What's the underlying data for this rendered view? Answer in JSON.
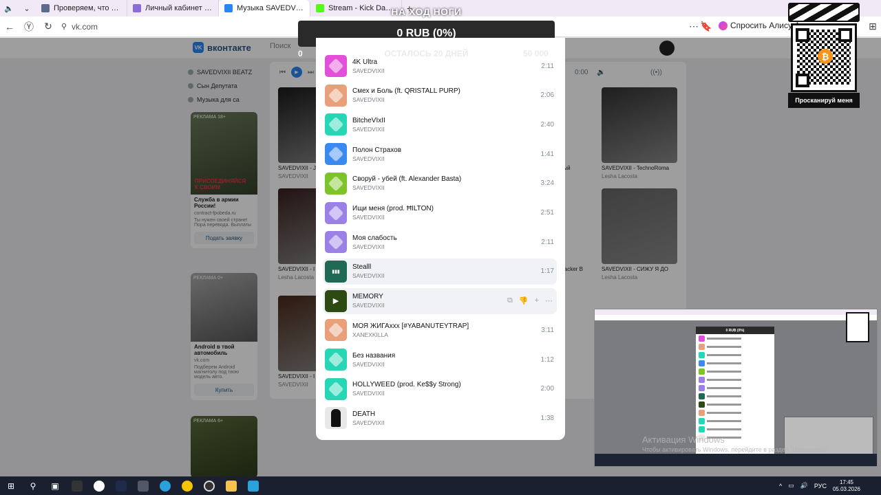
{
  "browser": {
    "tabs": [
      {
        "title": "Проверяем, что вы не ро",
        "color": "#5a6b8c"
      },
      {
        "title": "Личный кабинет - Мои об",
        "color": "#8a6cd8"
      },
      {
        "title": "Музыка SAVEDVIXII",
        "color": "#2787f5"
      },
      {
        "title": "Stream - Kick Dashb",
        "color": "#53fc18"
      }
    ],
    "active_tab": 2,
    "url": "vk.com",
    "alice_label": "Спросить Алису А"
  },
  "vk": {
    "logo": "вконтакте",
    "search_placeholder": "Поиск",
    "sidebar": [
      "SAVEDVIXII BEATZ",
      "Сын Депутата",
      "Музыка для са"
    ],
    "ad1": {
      "label": "РЕКЛАМА 18+",
      "title": "Служба в армии России!",
      "site": "contract-fpobeda.ru",
      "text": "Ты нужен своей стране! Пора перевода. Выплаты",
      "button": "Подать заявку",
      "promo": "ПРИСОЕДИНЯЙСЯ К СВОИМ"
    },
    "ad2": {
      "label": "РЕКЛАМА 0+",
      "title": "Android в твой автомобиль",
      "site": "vk.com",
      "text": "Подберем Android магнитолу под твою модель авто.",
      "button": "Купить"
    },
    "ad3": {
      "label": "РЕКЛАМА 6+"
    },
    "player_time": "0:00",
    "albums": [
      {
        "title": "SAVEDVIXII - J",
        "sub": "SAVEDVIXII"
      },
      {
        "title": "ный",
        "sub": ""
      },
      {
        "title": "SAVEDVIXII - TechnoRoma",
        "sub": "Lesha Lacosta"
      },
      {
        "title": "SAVEDVIXII - I",
        "sub": "Lesha Lacosta"
      },
      {
        "title": "Hacker B",
        "sub": ""
      },
      {
        "title": "SAVEDVIXII - СИЖУ Я ДО",
        "sub": "Lesha Lacosta"
      },
      {
        "title": "SAVEDVIXII - I",
        "sub": "SAVEDVIXII"
      }
    ]
  },
  "stream_overlay": {
    "goal_title": "НА ХОД НОГИ",
    "goal_value": "0 RUB (0%)",
    "goal_min": "0",
    "goal_remaining": "ОСТАЛОСЬ 20 ДНЕЙ",
    "goal_target": "50 000",
    "qr_label": "Просканируй меня",
    "btc_symbol": "₿"
  },
  "playlist": {
    "tracks": [
      {
        "title": "4K Ultra",
        "artist": "SAVEDVIXII",
        "duration": "2:11",
        "color": "#e24fd8"
      },
      {
        "title": "Смех и Боль (ft. QRISTALL PURP)",
        "artist": "SAVEDVIXII",
        "duration": "2:06",
        "color": "#e8a07a"
      },
      {
        "title": "BitcheVIxII",
        "artist": "SAVEDVIXII",
        "duration": "2:40",
        "color": "#26d6b4"
      },
      {
        "title": "Полон Страхов",
        "artist": "SAVEDVIXII",
        "duration": "1:41",
        "color": "#3b8af0"
      },
      {
        "title": "Своруй - убей (ft. Alexander Basta)",
        "artist": "SAVEDVIXII",
        "duration": "3:24",
        "color": "#7cc42a"
      },
      {
        "title": "Ищи меня (prod. ĦILTON)",
        "artist": "SAVEDVIXII",
        "duration": "2:51",
        "color": "#9b80e6"
      },
      {
        "title": "Моя слабость",
        "artist": "SAVEDVIXII",
        "duration": "2:11",
        "color": "#9b80e6"
      },
      {
        "title": "Stealll",
        "artist": "SAVEDVIXII",
        "duration": "1:17",
        "color": "#1e6a55"
      },
      {
        "title": "MEMORY",
        "artist": "SAVEDVIXII",
        "duration": "",
        "color": "#2d4a12"
      },
      {
        "title": "МОЯ ЖИГАxxx [#YABANUTEYTRAP]",
        "artist": "XANEXKILLA",
        "duration": "3:11",
        "color": "#e8a07a"
      },
      {
        "title": "Без названия",
        "artist": "SAVEDVIXII",
        "duration": "1:12",
        "color": "#26d6b4"
      },
      {
        "title": "HOLLYWEED (prod. Ke$$y Strong)",
        "artist": "SAVEDVIXII",
        "duration": "2:00",
        "color": "#26d6b4"
      },
      {
        "title": "DEATH",
        "artist": "SAVEDVIXII",
        "duration": "1:38",
        "color": "#e8e8e8"
      }
    ],
    "playing_index": 7,
    "hover_index": 8
  },
  "preview": {
    "goal_value": "0 RUB (0%)"
  },
  "watermark": {
    "title": "Активация Windows",
    "text": "Чтобы активировать Windows, перейдите в раздел \"Параметры\""
  },
  "taskbar": {
    "lang": "РУС",
    "time": "17:45",
    "date": "05.03.2026"
  }
}
